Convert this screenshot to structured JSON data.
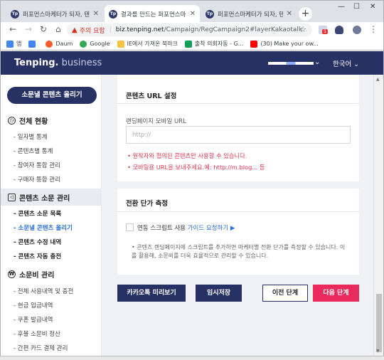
{
  "browser": {
    "tabs": [
      {
        "title": "퍼포먼스마케터가 되자, 텐",
        "favicon": "Tp"
      },
      {
        "title": "결과를 만드는 퍼포먼스마",
        "favicon": "Tp"
      },
      {
        "title": "퍼포먼스마케터가 되자, 텐",
        "favicon": "Tp"
      }
    ],
    "new_tab": "+",
    "window_controls": [
      "—",
      "☐",
      "✕"
    ],
    "security_warning": "주의 요함",
    "url_host": "biz.tenping.net",
    "url_path": "/Campaign/RegCampaign2#layerKakaotalk",
    "extension_badge": "1",
    "bookmarks": [
      {
        "label": "앱",
        "color": "#4285f4"
      },
      {
        "label": "",
        "color": "#4285f4"
      },
      {
        "label": "Daum",
        "color": "#ff5a2a"
      },
      {
        "label": "Google",
        "color": "#34a853"
      },
      {
        "label": "IE에서 가져온 북마크",
        "color": "#f6c343"
      },
      {
        "label": "출착 의회자동 - G...",
        "color": "#0f9d58"
      },
      {
        "label": "(30) Make your ow...",
        "color": "#ff0000"
      }
    ]
  },
  "header": {
    "logo_main": "Tenping.",
    "logo_sub": " business",
    "language": "한국어"
  },
  "sidebar": {
    "cta_label": "소문낼 콘텐츠 올리기",
    "sections": [
      {
        "title": "전체 현황",
        "icon": "clock-icon",
        "items": [
          "일자별 통계",
          "콘텐츠별 통계",
          "참여자 통합 관리",
          "구매자 통합 관리"
        ]
      },
      {
        "title": "콘텐츠 소문 관리",
        "icon": "megaphone-icon",
        "items": [
          "콘텐츠 소문 목록",
          "소문낼 콘텐츠 올리기",
          "콘텐츠 수정 내역",
          "콘텐츠 자동 충전"
        ]
      },
      {
        "title": "소문비 관리",
        "icon": "won-icon",
        "items": [
          "전체 사용내역 및 충전",
          "현금 입금내역",
          "쿠폰 발급내역",
          "후불 소문비 정산",
          "간편 카드 결제 관리"
        ]
      }
    ]
  },
  "main": {
    "url_card": {
      "title": "콘텐츠 URL 설정",
      "field_label": "랜딩페이지 모바일 URL",
      "placeholder": "http://",
      "notes": [
        "• 원작자와 협의된 콘텐츠만 사용할 수 있습니다.",
        "• 모바일용 URL을 보내주세요.예: http://m.blog... 등"
      ]
    },
    "conversion_card": {
      "title": "전환 단가 측정",
      "checkbox_label": "연동 스크립트 사용",
      "guide_link": "가이드 요청하기 ▶",
      "note": "• 콘텐츠 랜딩페이지에 스크립트를 추가하면 마케터별 전환 단가를 측정할 수 있습니다. 이를 활용해, 소문비를 더욱 효율적으로 관리할 수 있습니다."
    },
    "buttons": {
      "preview": "카카오톡 미리보기",
      "save_draft": "임시저장",
      "prev_step": "이전 단계",
      "next_step": "다음 단계"
    }
  }
}
